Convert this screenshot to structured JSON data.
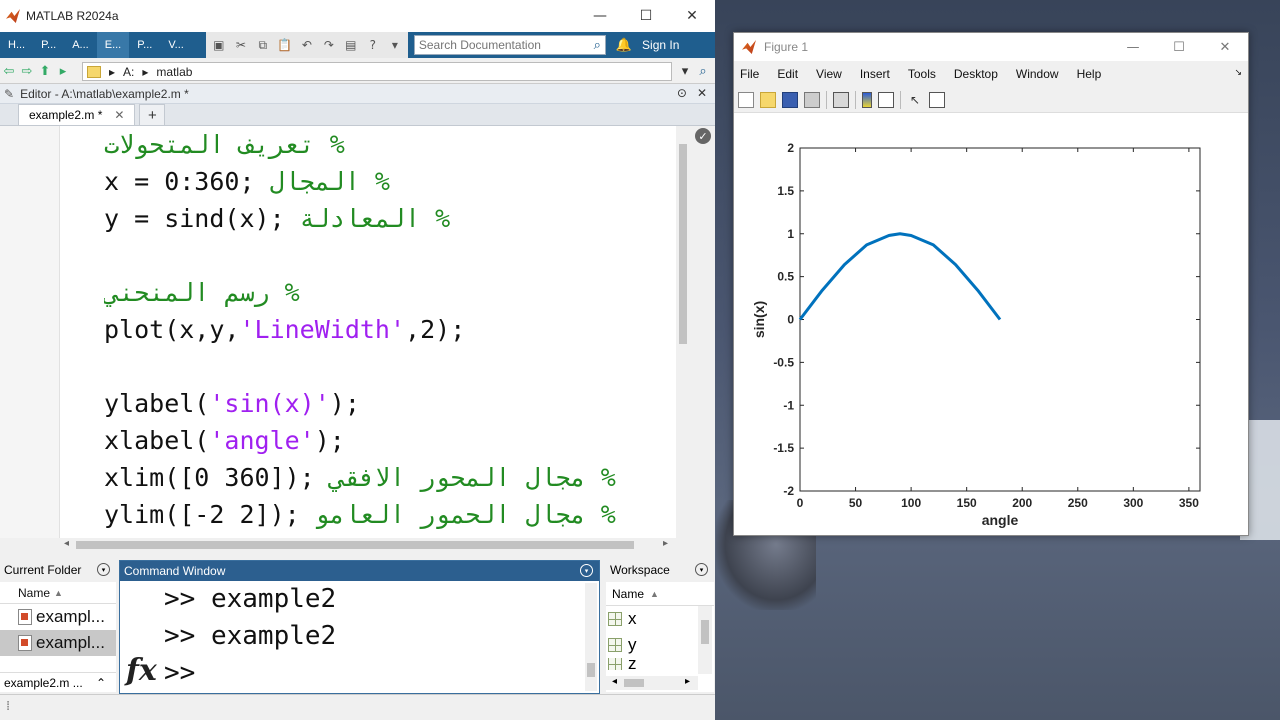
{
  "matlab": {
    "title": "MATLAB R2024a",
    "tabs": [
      "H...",
      "P...",
      "A...",
      "E...",
      "P...",
      "V..."
    ],
    "search_placeholder": "Search Documentation",
    "sign_in": "Sign In",
    "path": [
      "A:",
      "matlab"
    ]
  },
  "editor": {
    "header": "Editor - A:\\matlab\\example2.m *",
    "tab_label": "example2.m *",
    "lines": [
      [
        {
          "t": "% تعريف المتحولات",
          "c": "cm"
        }
      ],
      [
        {
          "t": "x = 0:360; ",
          "c": ""
        },
        {
          "t": "% المجال",
          "c": "cm"
        }
      ],
      [
        {
          "t": "y = sind(x); ",
          "c": ""
        },
        {
          "t": "% المعادلة",
          "c": "cm"
        }
      ],
      [
        {
          "t": "",
          "c": ""
        }
      ],
      [
        {
          "t": "% رسم المنحني",
          "c": "cm"
        }
      ],
      [
        {
          "t": "plot(x,y,",
          "c": ""
        },
        {
          "t": "'LineWidth'",
          "c": "str"
        },
        {
          "t": ",2);",
          "c": ""
        }
      ],
      [
        {
          "t": "",
          "c": ""
        }
      ],
      [
        {
          "t": "ylabel(",
          "c": ""
        },
        {
          "t": "'sin(x)'",
          "c": "str"
        },
        {
          "t": ");",
          "c": ""
        }
      ],
      [
        {
          "t": "xlabel(",
          "c": ""
        },
        {
          "t": "'angle'",
          "c": "str"
        },
        {
          "t": ");",
          "c": ""
        }
      ],
      [
        {
          "t": "xlim([0 360]); ",
          "c": ""
        },
        {
          "t": "% مجال المحور الافقي",
          "c": "cm"
        }
      ],
      [
        {
          "t": "ylim([-2 2]); ",
          "c": ""
        },
        {
          "t": "% مجال الحمور العامو",
          "c": "cm"
        }
      ]
    ]
  },
  "current_folder": {
    "title": "Current Folder",
    "column": "Name",
    "items": [
      "exampl...",
      "exampl..."
    ],
    "footer": "example2.m ..."
  },
  "command_window": {
    "title": "Command Window",
    "lines": [
      ">> example2",
      ">> example2",
      ">>"
    ]
  },
  "workspace": {
    "title": "Workspace",
    "column": "Name",
    "variables": [
      "x",
      "y",
      "z"
    ]
  },
  "figure": {
    "title": "Figure 1",
    "menu": [
      "File",
      "Edit",
      "View",
      "Insert",
      "Tools",
      "Desktop",
      "Window",
      "Help"
    ]
  },
  "chart_data": {
    "type": "line",
    "title": "",
    "xlabel": "angle",
    "ylabel": "sin(x)",
    "xlim": [
      0,
      360
    ],
    "ylim": [
      -2,
      2
    ],
    "xticks": [
      0,
      50,
      100,
      150,
      200,
      250,
      300,
      350
    ],
    "yticks": [
      -2,
      -1.5,
      -1,
      -0.5,
      0,
      0.5,
      1,
      1.5,
      2
    ],
    "grid": false,
    "series": [
      {
        "color": "#1f77b4",
        "x": [
          0,
          20,
          40,
          60,
          80,
          90,
          100,
          120,
          140,
          160,
          180
        ],
        "y": [
          0,
          0.34,
          0.64,
          0.87,
          0.98,
          1.0,
          0.98,
          0.87,
          0.64,
          0.34,
          0
        ]
      }
    ]
  }
}
